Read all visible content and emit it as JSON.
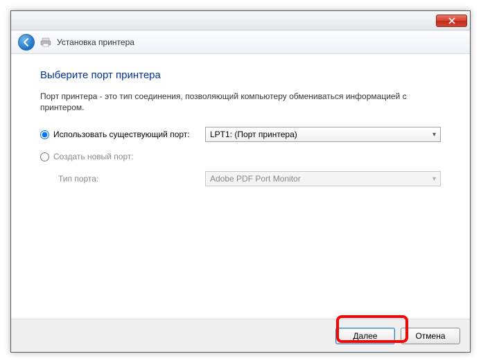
{
  "header": {
    "title": "Установка принтера"
  },
  "page": {
    "heading": "Выберите порт принтера",
    "description": "Порт принтера - это тип соединения, позволяющий компьютеру обмениваться информацией с принтером."
  },
  "options": {
    "use_existing": {
      "label": "Использовать существующий порт:",
      "selected_value": "LPT1: (Порт принтера)",
      "checked": true
    },
    "create_new": {
      "label": "Создать новый порт:",
      "checked": false
    },
    "port_type": {
      "label": "Тип порта:",
      "selected_value": "Adobe PDF Port Monitor",
      "enabled": false
    }
  },
  "buttons": {
    "next": "Далее",
    "cancel": "Отмена"
  }
}
